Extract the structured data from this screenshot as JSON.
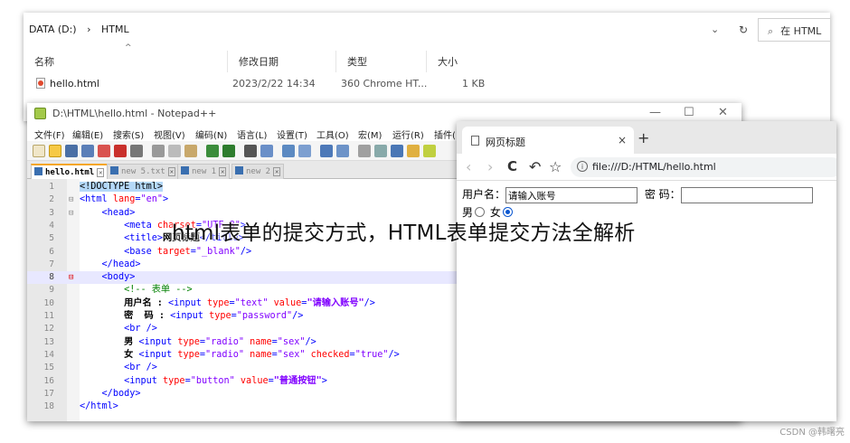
{
  "explorer": {
    "breadcrumb": [
      "DATA (D:)",
      "›",
      "HTML"
    ],
    "dropdown": "⌄",
    "refresh": "↻",
    "search_placeholder": "在 HTML",
    "search_icon": "search-icon",
    "columns": [
      "名称",
      "修改日期",
      "类型",
      "大小"
    ],
    "sort_indicator": "^",
    "files": [
      {
        "name": "hello.html",
        "modified": "2023/2/22 14:34",
        "type": "360 Chrome HT...",
        "size": "1 KB"
      }
    ]
  },
  "notepad": {
    "title": "D:\\HTML\\hello.html - Notepad++",
    "window_controls": [
      "—",
      "☐",
      "✕"
    ],
    "menu": [
      "文件(F)",
      "编辑(E)",
      "搜索(S)",
      "视图(V)",
      "编码(N)",
      "语言(L)",
      "设置(T)",
      "工具(O)",
      "宏(M)",
      "运行(R)",
      "插件("
    ],
    "tabs": [
      {
        "label": "hello.html",
        "active": true
      },
      {
        "label": "new 5.txt",
        "active": false
      },
      {
        "label": "new 1",
        "active": false
      },
      {
        "label": "new 2",
        "active": false
      }
    ],
    "line_numbers": [
      "1",
      "2",
      "3",
      "4",
      "5",
      "6",
      "7",
      "8",
      "9",
      "10",
      "11",
      "12",
      "13",
      "14",
      "15",
      "16",
      "17",
      "18"
    ],
    "current_line": 8
  },
  "browser": {
    "tab_title": "网页标题",
    "tab_close": "×",
    "new_tab": "+",
    "nav": {
      "back": "‹",
      "forward": "›",
      "reload": "C",
      "undo": "↶",
      "star": "☆"
    },
    "url": "file:///D:/HTML/hello.html",
    "form": {
      "username_label": "用户名：",
      "username_value": "请输入账号",
      "password_label": "密 码：",
      "male_label": "男",
      "female_label": "女"
    }
  },
  "caption": "html表单的提交方式，HTML表单提交方法全解析",
  "watermark": "CSDN @韩曙亮"
}
